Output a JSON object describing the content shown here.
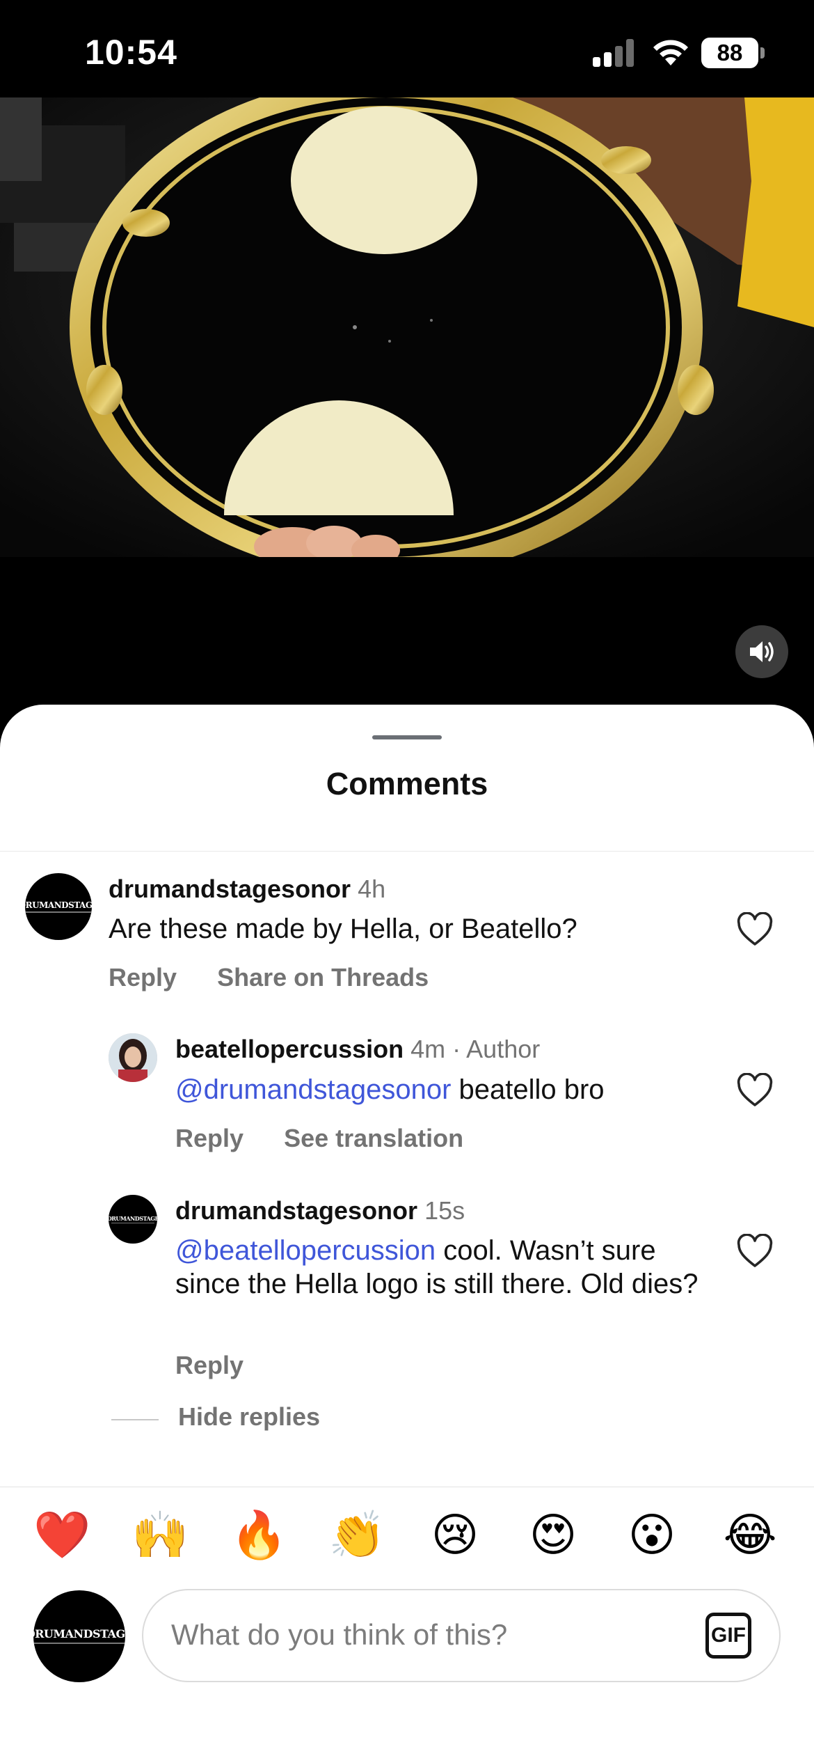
{
  "status_bar": {
    "time": "10:54",
    "battery": "88"
  },
  "sheet": {
    "title": "Comments"
  },
  "comments": [
    {
      "username": "drumandstagesonor",
      "time": "4h",
      "tag": "",
      "mention": "",
      "text": "Are these made by Hella, or Beatello?",
      "actions": [
        "Reply",
        "Share on Threads"
      ],
      "avatar_text": "DRUMANDSTAGE"
    },
    {
      "username": "beatellopercussion",
      "time": "4m",
      "tag": "Author",
      "mention": "@drumandstagesonor",
      "text": " beatello bro",
      "actions": [
        "Reply",
        "See translation"
      ]
    },
    {
      "username": "drumandstagesonor",
      "time": "15s",
      "tag": "",
      "mention": "@beatellopercussion",
      "text": " cool. Wasn’t sure since the Hella logo is still there. Old dies?",
      "actions": [
        "Reply"
      ],
      "avatar_text": "DRUMANDSTAGE"
    }
  ],
  "replies_toggle": "Hide replies",
  "emoji_reactions": [
    "❤️",
    "🙌",
    "🔥",
    "👏",
    "😢",
    "😍",
    "😮",
    "😂"
  ],
  "composer": {
    "placeholder": "What do you think of this?",
    "gif_label": "GIF",
    "avatar_text": "DRUMANDSTAGE"
  },
  "colors": {
    "mention": "#3f56d9",
    "secondary_text": "#737373",
    "sheet_bg": "#ffffff"
  }
}
